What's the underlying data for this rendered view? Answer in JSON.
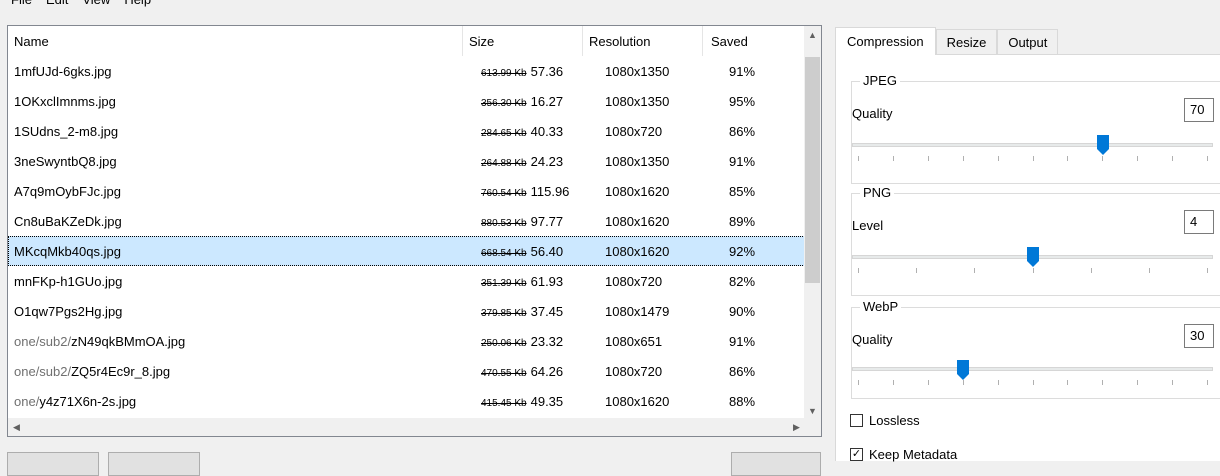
{
  "menu": [
    "File",
    "Edit",
    "View",
    "Help"
  ],
  "columns": {
    "name": "Name",
    "size": "Size",
    "resolution": "Resolution",
    "saved": "Saved"
  },
  "files": [
    {
      "prefix": "",
      "name": "1mfUJd-6gks.jpg",
      "original": "613.99 Kb",
      "size": "57.36",
      "resolution": "1080x1350",
      "saved": "91%"
    },
    {
      "prefix": "",
      "name": "1OKxclImnms.jpg",
      "original": "356.30 Kb",
      "size": "16.27",
      "resolution": "1080x1350",
      "saved": "95%"
    },
    {
      "prefix": "",
      "name": "1SUdns_2-m8.jpg",
      "original": "284.65 Kb",
      "size": "40.33",
      "resolution": "1080x720",
      "saved": "86%"
    },
    {
      "prefix": "",
      "name": "3neSwyntbQ8.jpg",
      "original": "264.88 Kb",
      "size": "24.23",
      "resolution": "1080x1350",
      "saved": "91%"
    },
    {
      "prefix": "",
      "name": "A7q9mOybFJc.jpg",
      "original": "760.54 Kb",
      "size": "115.96",
      "resolution": "1080x1620",
      "saved": "85%"
    },
    {
      "prefix": "",
      "name": "Cn8uBaKZeDk.jpg",
      "original": "880.53 Kb",
      "size": "97.77",
      "resolution": "1080x1620",
      "saved": "89%"
    },
    {
      "prefix": "",
      "name": "MKcqMkb40qs.jpg",
      "original": "668.54 Kb",
      "size": "56.40",
      "resolution": "1080x1620",
      "saved": "92%"
    },
    {
      "prefix": "",
      "name": "mnFKp-h1GUo.jpg",
      "original": "351.39 Kb",
      "size": "61.93",
      "resolution": "1080x720",
      "saved": "82%"
    },
    {
      "prefix": "",
      "name": "O1qw7Pgs2Hg.jpg",
      "original": "379.85 Kb",
      "size": "37.45",
      "resolution": "1080x1479",
      "saved": "90%"
    },
    {
      "prefix": "one/sub2/",
      "name": "zN49qkBMmOA.jpg",
      "original": "250.06 Kb",
      "size": "23.32",
      "resolution": "1080x651",
      "saved": "91%"
    },
    {
      "prefix": "one/sub2/",
      "name": "ZQ5r4Ec9r_8.jpg",
      "original": "470.55 Kb",
      "size": "64.26",
      "resolution": "1080x720",
      "saved": "86%"
    },
    {
      "prefix": "one/",
      "name": "y4z71X6n-2s.jpg",
      "original": "415.45 Kb",
      "size": "49.35",
      "resolution": "1080x1620",
      "saved": "88%"
    }
  ],
  "selected_row": 6,
  "tabs": [
    "Compression",
    "Resize",
    "Output"
  ],
  "active_tab": 0,
  "groups": {
    "jpeg": {
      "legend": "JPEG",
      "label": "Quality",
      "value": "70",
      "level": 0.7
    },
    "png": {
      "legend": "PNG",
      "label": "Level",
      "value": "4",
      "level": 0.5
    },
    "webp": {
      "legend": "WebP",
      "label": "Quality",
      "value": "30",
      "level": 0.3
    }
  },
  "checkboxes": {
    "lossless": {
      "label": "Lossless",
      "checked": false
    },
    "keep_metadata": {
      "label": "Keep Metadata",
      "checked": true
    }
  },
  "icons": {
    "scroll_up": "▲",
    "scroll_down": "▼",
    "scroll_left": "◀",
    "scroll_right": "▶"
  },
  "colors": {
    "selection": "#cce8ff",
    "slider_thumb": "#0078d7"
  }
}
